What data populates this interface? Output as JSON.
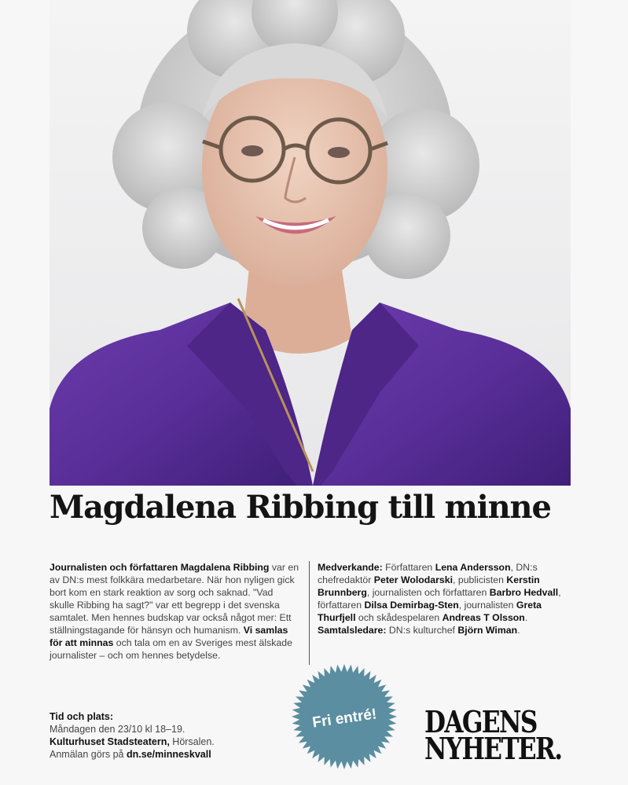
{
  "photo": {
    "alt": ""
  },
  "headline": "Magdalena Ribbing till minne",
  "left_column": {
    "lead_bold": "Journalisten och författaren Magdalena Ribbing",
    "text1": " var en av DN:s mest folkkära medarbetare. När hon nyligen gick bort kom en stark reaktion av sorg och saknad. \"Vad skulle Ribbing ha sagt?\" var ett begrepp i det svenska samtalet. Men hennes budskap var också något mer: Ett ställningstagande för hänsyn och humanism. ",
    "bold2": "Vi samlas för att minnas",
    "text2": " och tala om en av Sveriges mest älskade journalister – och om hennes betydelse."
  },
  "right_column": {
    "label1": "Medverkande:",
    "t1": " Författaren ",
    "n1": "Lena Andersson",
    "t2": ", DN:s chefredaktör ",
    "n2": "Peter Wolodarski",
    "t3": ", publicisten ",
    "n3": "Kerstin Brunnberg",
    "t4": ", journalisten och författaren ",
    "n4": "Barbro Hedvall",
    "t5": ", författaren ",
    "n5": "Dilsa Demirbag-Sten",
    "t6": ", journalisten ",
    "n6": "Greta Thurfjell",
    "t7": " och skådespelaren ",
    "n7": "Andreas T Olsson",
    "t8": ".",
    "label2": "Samtalsledare:",
    "t9": " DN:s kulturchef ",
    "n8": "Björn Wiman",
    "t10": "."
  },
  "info": {
    "title": "Tid och plats:",
    "line1": "Måndagen den 23/10 kl 18–19.",
    "venue": "Kulturhuset Stadsteatern,",
    "venue_rest": " Hörsalen.",
    "signup": "Anmälan görs på ",
    "url": "dn.se/minneskvall"
  },
  "badge": {
    "text": "Fri entré!",
    "color": "#5a8ea0"
  },
  "logo": {
    "line1": "DAGENS",
    "line2": "NYHETER."
  },
  "colors": {
    "blouse": "#5b2f9a",
    "background": "#f7f7f7"
  }
}
